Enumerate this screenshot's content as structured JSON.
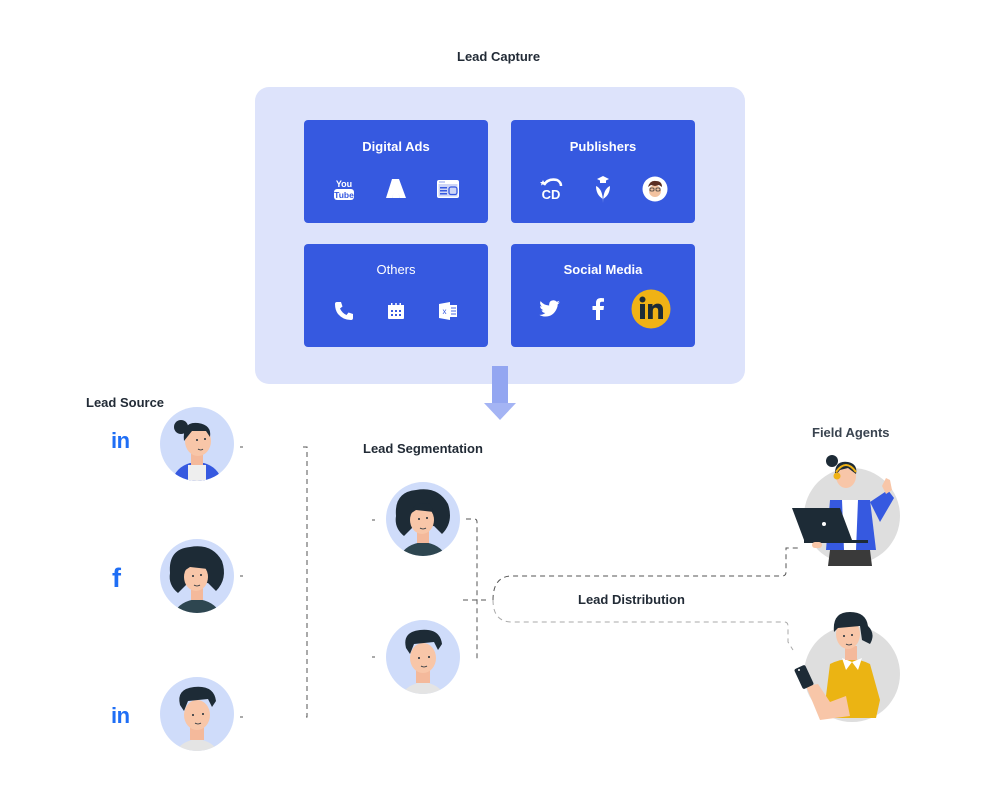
{
  "lead_capture": {
    "title": "Lead Capture",
    "cards": [
      {
        "title": "Digital Ads",
        "icons": [
          "youtube-icon",
          "google-ads-icon",
          "display-ad-icon"
        ]
      },
      {
        "title": "Publishers",
        "icons": [
          "cd-publisher-icon",
          "education-publisher-icon",
          "avatar-publisher-icon"
        ]
      },
      {
        "title": "Others",
        "icons": [
          "phone-icon",
          "calendar-icon",
          "excel-icon"
        ]
      },
      {
        "title": "Social Media",
        "icons": [
          "twitter-icon",
          "facebook-icon",
          "linkedin-icon"
        ]
      }
    ],
    "highlighted_icon": "linkedin-icon",
    "highlight_color": "#f0b215",
    "card_color": "#3659e0",
    "panel_color": "#dde3fb"
  },
  "lead_source": {
    "title": "Lead Source",
    "items": [
      {
        "channel": "linkedin",
        "glyph": "in"
      },
      {
        "channel": "facebook",
        "glyph": "f"
      },
      {
        "channel": "linkedin",
        "glyph": "in"
      }
    ],
    "channel_color": "#1f6ef5"
  },
  "lead_segmentation": {
    "title": "Lead Segmentation",
    "people": 2
  },
  "lead_distribution": {
    "title": "Lead Distribution"
  },
  "field_agents": {
    "title": "Field Agents",
    "agents": [
      "agent-with-laptop",
      "agent-with-phone"
    ]
  }
}
